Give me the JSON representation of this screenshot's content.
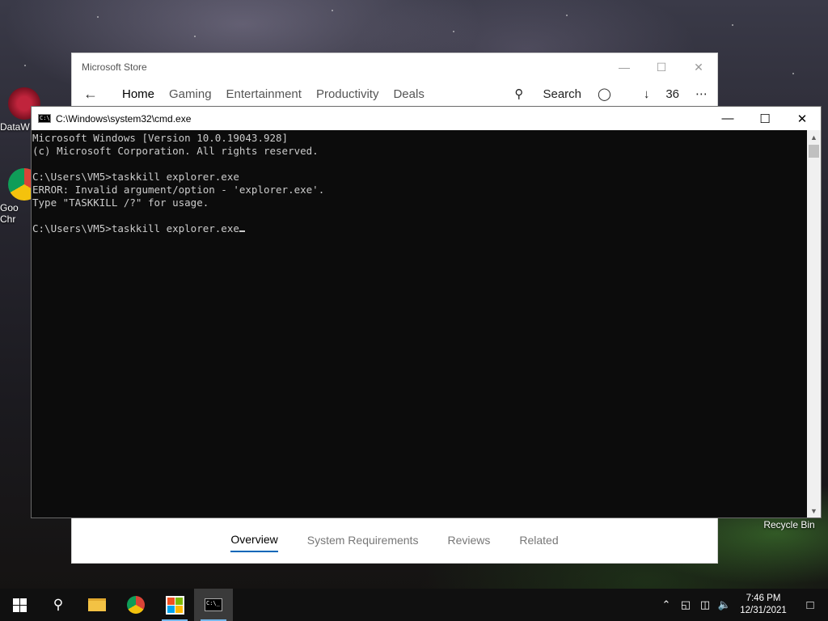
{
  "desktop": {
    "icons": [
      {
        "label": "DataW",
        "icon": "datawrapper-icon"
      },
      {
        "label": "Goo Chr",
        "icon": "google-chrome-icon"
      },
      {
        "label": "Recycle Bin",
        "icon": "recycle-bin-icon"
      }
    ]
  },
  "store": {
    "title": "Microsoft Store",
    "nav": {
      "home": "Home",
      "gaming": "Gaming",
      "entertainment": "Entertainment",
      "productivity": "Productivity",
      "deals": "Deals",
      "search": "Search",
      "downloads": "36"
    },
    "tabs": {
      "overview": "Overview",
      "system_requirements": "System Requirements",
      "reviews": "Reviews",
      "related": "Related"
    },
    "accent": "#0067b8"
  },
  "cmd": {
    "title": "C:\\Windows\\system32\\cmd.exe",
    "lines": [
      "Microsoft Windows [Version 10.0.19043.928]",
      "(c) Microsoft Corporation. All rights reserved.",
      "",
      "C:\\Users\\VM5>taskkill explorer.exe",
      "ERROR: Invalid argument/option - 'explorer.exe'.",
      "Type \"TASKKILL /?\" for usage.",
      "",
      "C:\\Users\\VM5>taskkill explorer.exe"
    ]
  },
  "taskbar": {
    "apps": [
      "start-icon",
      "search-icon",
      "file-explorer-icon",
      "chrome-icon",
      "store-icon",
      "cmd-icon"
    ],
    "time": "7:46 PM",
    "date": "12/31/2021"
  }
}
